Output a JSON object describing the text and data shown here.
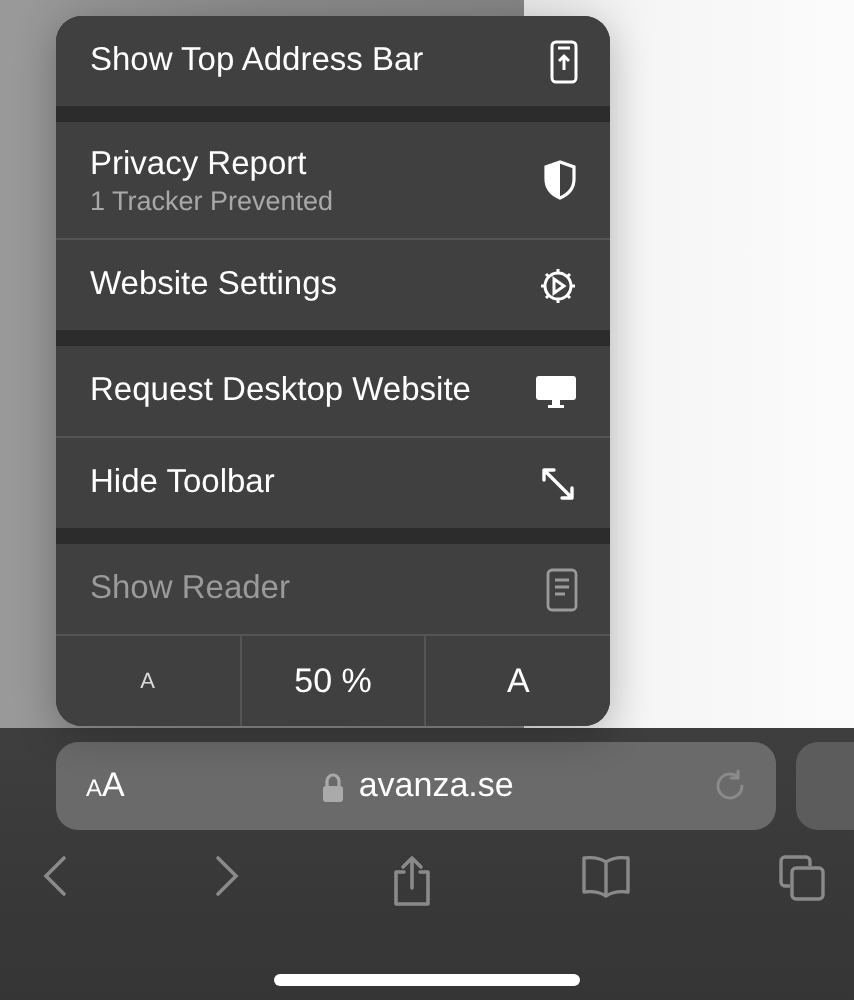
{
  "menu": {
    "sections": [
      {
        "items": [
          {
            "label": "Show Top Address Bar",
            "disabled": false
          }
        ]
      },
      {
        "items": [
          {
            "label": "Privacy Report",
            "subtitle": "1 Tracker Prevented",
            "disabled": false
          },
          {
            "label": "Website Settings",
            "disabled": false
          }
        ]
      },
      {
        "items": [
          {
            "label": "Request Desktop Website",
            "disabled": false
          },
          {
            "label": "Hide Toolbar",
            "disabled": false
          }
        ]
      },
      {
        "items": [
          {
            "label": "Show Reader",
            "disabled": true
          }
        ]
      }
    ],
    "zoom_row": {
      "smaller": "A",
      "zoom": "50 %",
      "larger": "A"
    }
  },
  "address_bar": {
    "text_size_small": "A",
    "text_size_large": "A",
    "url": "avanza.se"
  }
}
